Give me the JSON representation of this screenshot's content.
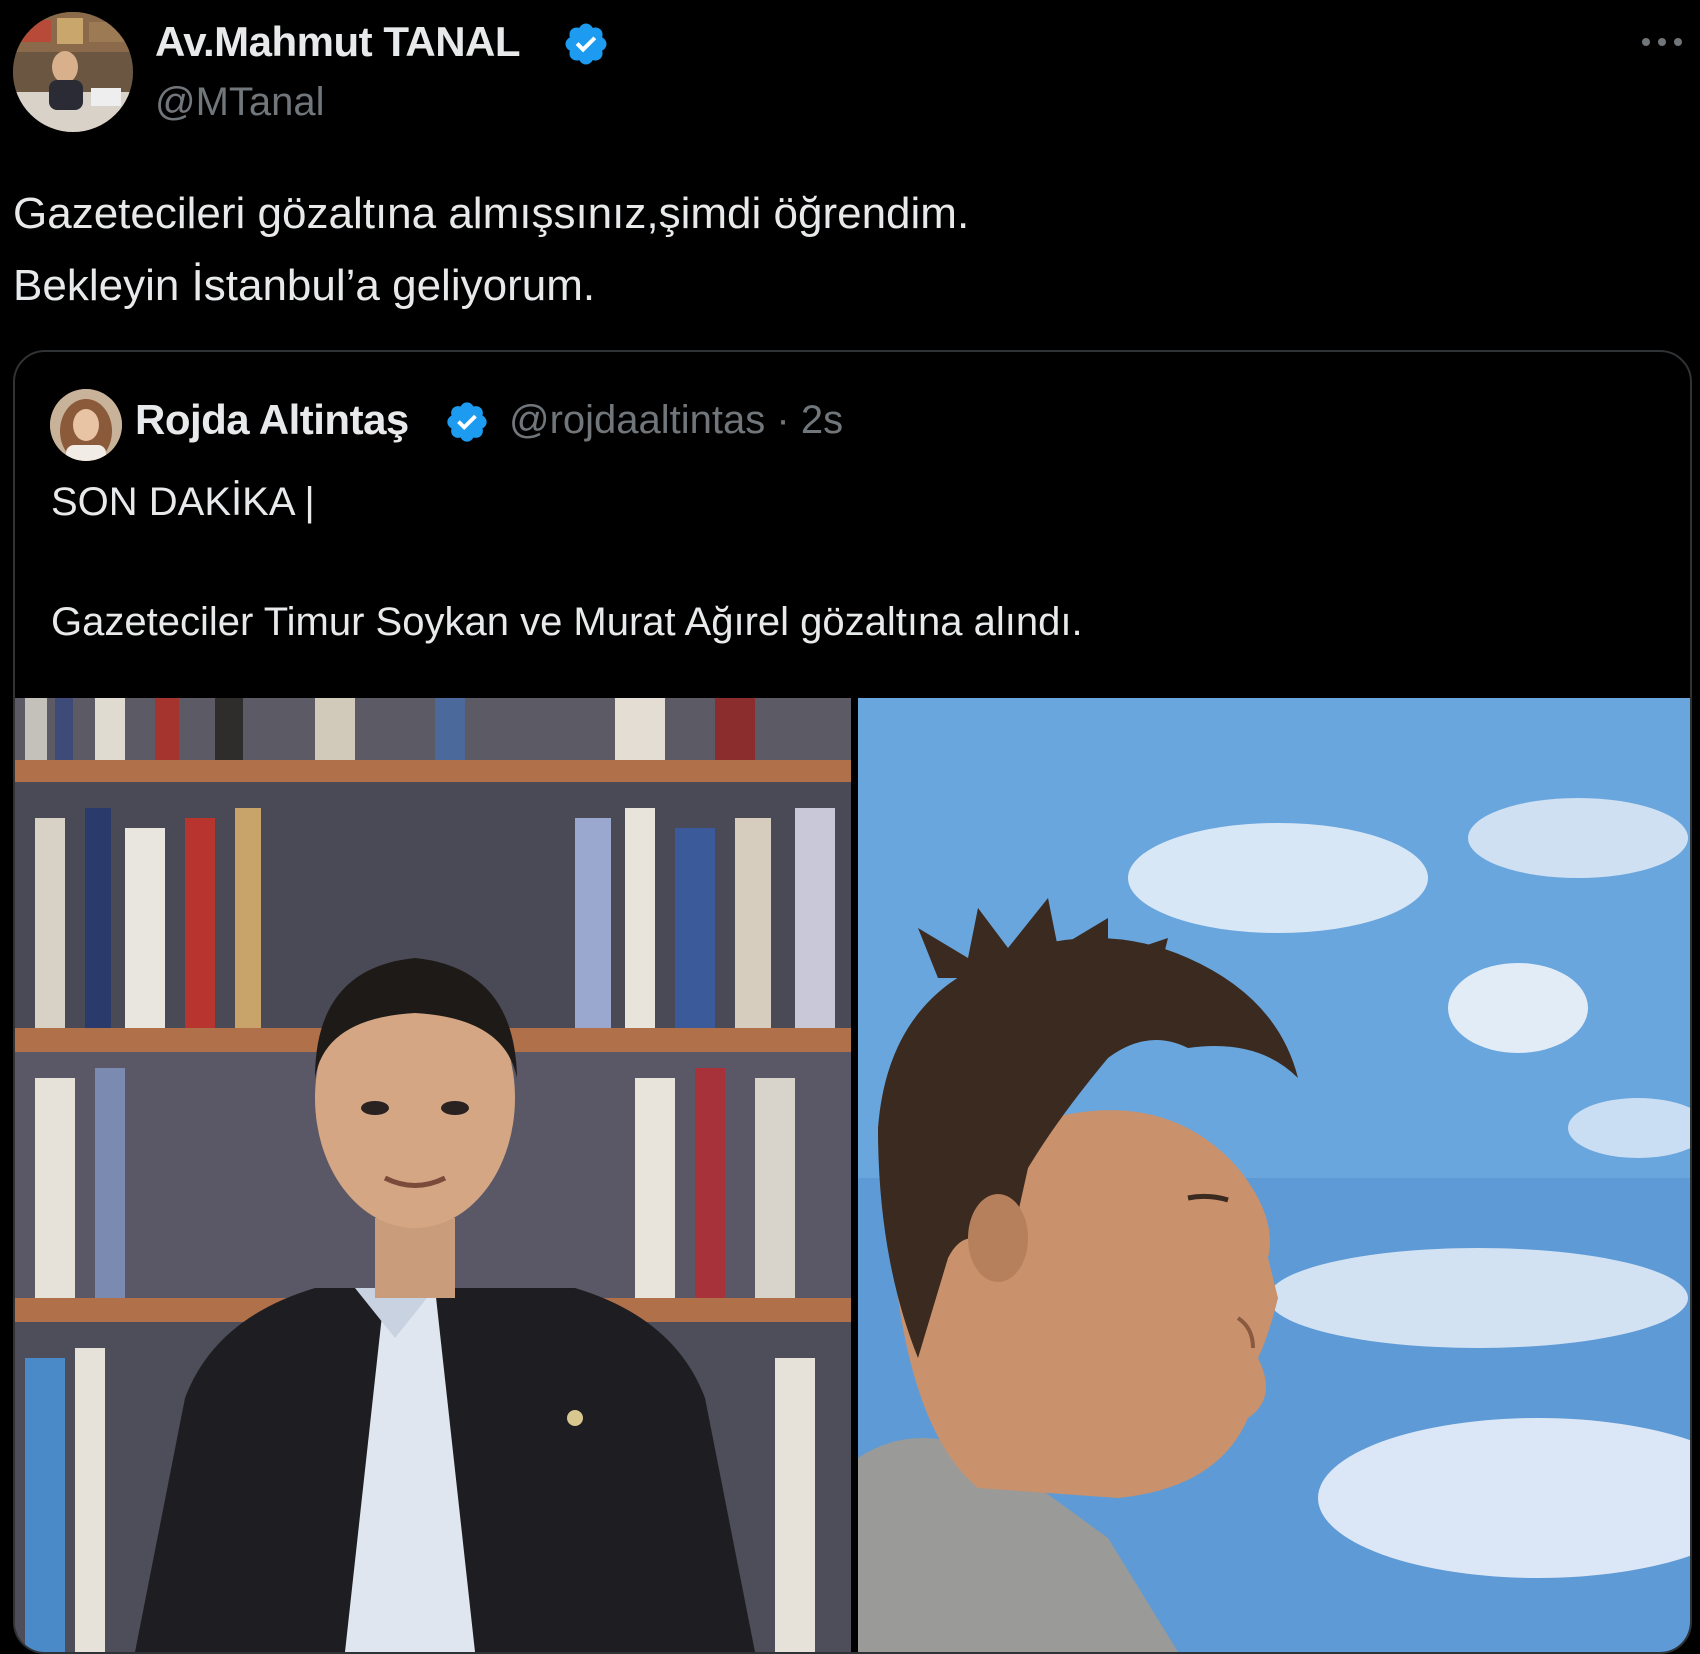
{
  "author": {
    "name": "Av.Mahmut TANAL",
    "handle": "@MTanal",
    "verified": true
  },
  "tweet": {
    "lines": [
      "Gazetecileri gözaltına almışsınız,şimdi öğrendim.",
      "Bekleyin İstanbul’a geliyorum."
    ]
  },
  "quoted_tweet": {
    "name": "Rojda Altintaş",
    "handle": "@rojdaaltintas",
    "separator": "·",
    "time": "2s",
    "verified": true,
    "lines": [
      "SON DAKİKA |",
      "Gazeteciler Timur Soykan ve Murat Ağırel gözaltına alındı."
    ],
    "media": [
      {
        "icon": "photo-man-in-suit-bookshelf"
      },
      {
        "icon": "photo-man-profile-sky"
      }
    ]
  },
  "colors": {
    "background": "#000000",
    "text": "#e7e9ea",
    "secondary": "#71767b",
    "verified": "#1d9bf0",
    "border": "#2f3336"
  }
}
